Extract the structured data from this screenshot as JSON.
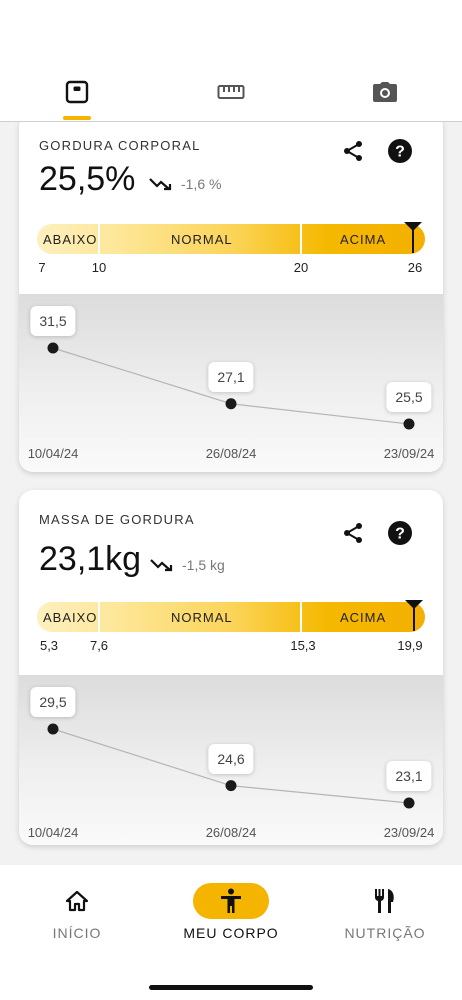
{
  "top_tabs": [
    {
      "icon": "scale-icon",
      "active": true
    },
    {
      "icon": "ruler-icon",
      "active": false
    },
    {
      "icon": "camera-icon",
      "active": false
    }
  ],
  "colors": {
    "accent": "#f4b400"
  },
  "cards": [
    {
      "title": "GORDURA CORPORAL",
      "value": "25,5%",
      "trend": "-1,6 %",
      "range_labels": {
        "low": "ABAIXO",
        "normal": "NORMAL",
        "high": "ACIMA"
      },
      "range_ticks": [
        "7",
        "10",
        "20",
        "26"
      ],
      "chart_data": {
        "type": "line",
        "x": [
          "10/04/24",
          "26/08/24",
          "23/09/24"
        ],
        "values": [
          31.5,
          27.1,
          25.5
        ],
        "value_labels": [
          "31,5",
          "27,1",
          "25,5"
        ]
      }
    },
    {
      "title": "MASSA DE GORDURA",
      "value": "23,1kg",
      "trend": "-1,5 kg",
      "range_labels": {
        "low": "ABAIXO",
        "normal": "NORMAL",
        "high": "ACIMA"
      },
      "range_ticks": [
        "5,3",
        "7,6",
        "15,3",
        "19,9"
      ],
      "chart_data": {
        "type": "line",
        "x": [
          "10/04/24",
          "26/08/24",
          "23/09/24"
        ],
        "values": [
          29.5,
          24.6,
          23.1
        ],
        "value_labels": [
          "29,5",
          "24,6",
          "23,1"
        ]
      }
    }
  ],
  "bottom_nav": [
    {
      "label": "INÍCIO",
      "icon": "home-icon"
    },
    {
      "label": "MEU CORPO",
      "icon": "person-icon"
    },
    {
      "label": "NUTRIÇÃO",
      "icon": "fork-knife-icon"
    }
  ]
}
